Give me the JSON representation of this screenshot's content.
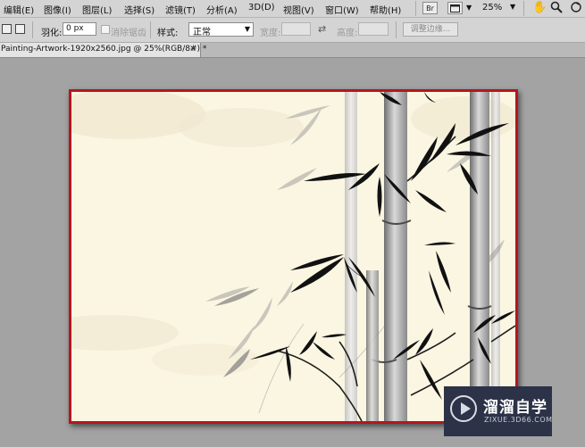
{
  "menubar": {
    "items": [
      "编辑(E)",
      "图像(I)",
      "图层(L)",
      "选择(S)",
      "滤镜(T)",
      "分析(A)",
      "3D(D)",
      "视图(V)",
      "窗口(W)",
      "帮助(H)"
    ],
    "bridge_label": "Br",
    "zoom": "25%"
  },
  "options": {
    "feather_label": "羽化:",
    "feather_value": "0 px",
    "antialias_label": "消除锯齿",
    "style_label": "样式:",
    "style_value": "正常",
    "width_label": "宽度:",
    "height_label": "高度:",
    "refine_edge_label": "调整边缘..."
  },
  "document": {
    "tab_title": "Painting-Artwork-1920x2560.jpg @ 25%(RGB/8#) *",
    "close": "×"
  },
  "watermark": {
    "title": "溜溜自学",
    "subtitle": "ZIXUE.3D66.COM"
  },
  "colors": {
    "border_accent": "#b4161e",
    "paper": "#fbf6e2",
    "watermark_bg": "#2c3247"
  }
}
